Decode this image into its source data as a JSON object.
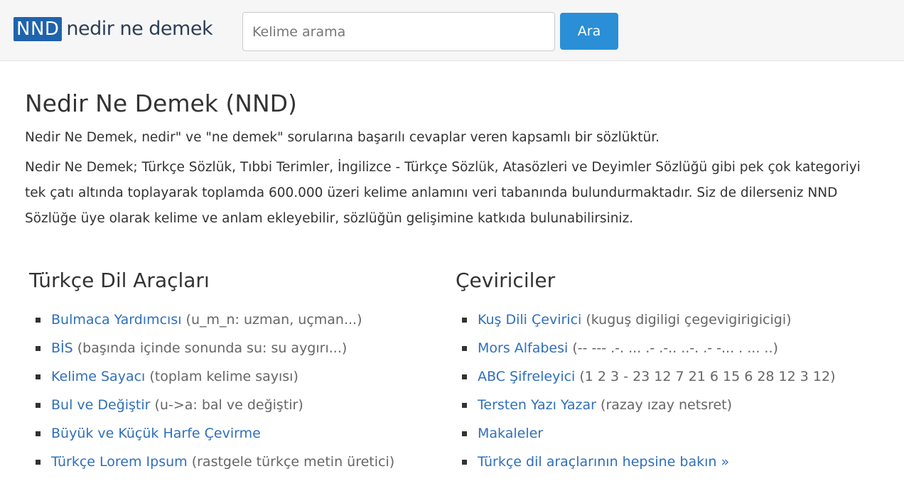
{
  "header": {
    "logo_badge": "NND",
    "logo_text": "nedir ne demek",
    "search_placeholder": "Kelime arama",
    "search_button": "Ara"
  },
  "main": {
    "title": "Nedir Ne Demek (NND)",
    "intro": "Nedir Ne Demek, nedir\" ve \"ne demek\" sorularına başarılı cevaplar veren kapsamlı bir sözlüktür.",
    "description": "Nedir Ne Demek; Türkçe Sözlük, Tıbbi Terimler, İngilizce - Türkçe Sözlük, Atasözleri ve Deyimler Sözlüğü gibi pek çok kategoriyi tek çatı altında toplayarak toplamda 600.000 üzeri kelime anlamını veri tabanında bulundurmaktadır. Siz de dilerseniz NND Sözlüğe üye olarak kelime ve anlam ekleyebilir, sözlüğün gelişimine katkıda bulunabilirsiniz."
  },
  "tools": {
    "heading": "Türkçe Dil Araçları",
    "items": [
      {
        "label": "Bulmaca Yardımcısı",
        "note": "(u_m_n: uzman, uçman...)"
      },
      {
        "label": "BİS",
        "note": "(başında içinde sonunda su: su aygırı...)"
      },
      {
        "label": "Kelime Sayacı",
        "note": "(toplam kelime sayısı)"
      },
      {
        "label": "Bul ve Değiştir",
        "note": "(u->a: bal ve değiştir)"
      },
      {
        "label": "Büyük ve Küçük Harfe Çevirme",
        "note": ""
      },
      {
        "label": "Türkçe Lorem Ipsum",
        "note": "(rastgele türkçe metin üretici)"
      }
    ]
  },
  "translators": {
    "heading": "Çeviriciler",
    "items": [
      {
        "label": "Kuş Dili Çevirici",
        "note": "(kuguş digiligi çegevigirigicigi)"
      },
      {
        "label": "Mors Alfabesi",
        "note": "(-- --- .-. ... .- .-.. ..-. .- -... . ... ..)"
      },
      {
        "label": "ABC Şifreleyici",
        "note": "(1 2 3 - 23 12 7 21 6 15 6 28 12 3 12)"
      },
      {
        "label": "Tersten Yazı Yazar",
        "note": "(razay ızay netsret)"
      },
      {
        "label": "Makaleler",
        "note": ""
      },
      {
        "label": "Türkçe dil araçlarının hepsine bakın »",
        "note": ""
      }
    ]
  }
}
